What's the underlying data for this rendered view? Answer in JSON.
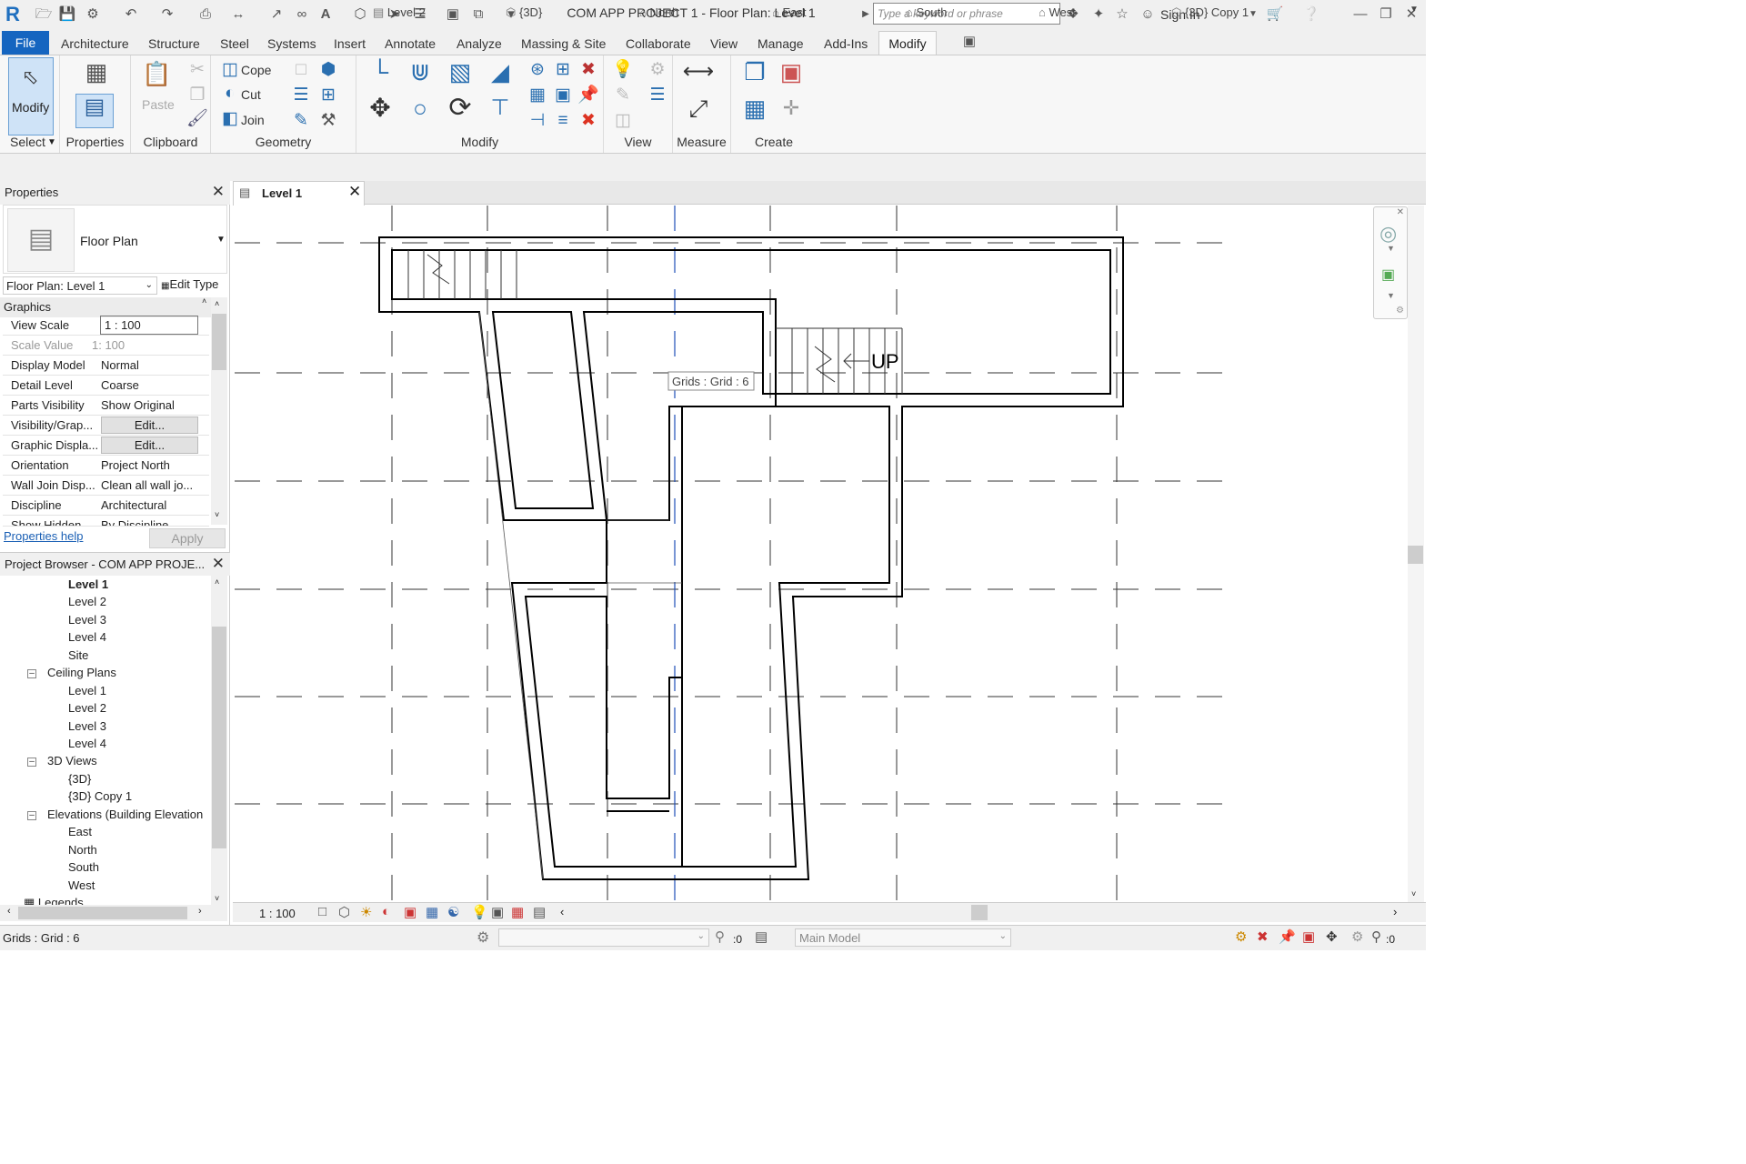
{
  "window": {
    "title": "COM APP PROJECT 1 - Floor Plan: Level 1",
    "search_placeholder": "Type a keyword or phrase",
    "sign_in": "Sign In"
  },
  "menu": [
    "File",
    "Architecture",
    "Structure",
    "Steel",
    "Systems",
    "Insert",
    "Annotate",
    "Analyze",
    "Massing & Site",
    "Collaborate",
    "View",
    "Manage",
    "Add-Ins",
    "Modify"
  ],
  "ribbon": {
    "select": {
      "modify": "Modify",
      "label": "Select"
    },
    "properties": {
      "label": "Properties"
    },
    "clipboard": {
      "paste": "Paste",
      "label": "Clipboard"
    },
    "geometry": {
      "cope": "Cope",
      "cut": "Cut",
      "join": "Join",
      "label": "Geometry"
    },
    "modify_panel": {
      "label": "Modify"
    },
    "view": {
      "label": "View"
    },
    "measure": {
      "label": "Measure"
    },
    "create": {
      "label": "Create"
    }
  },
  "properties": {
    "title": "Properties",
    "type_name": "Floor Plan",
    "instance": "Floor Plan: Level 1",
    "edit_type": "Edit Type",
    "group": "Graphics",
    "rows": [
      {
        "k": "View Scale",
        "v": "1 : 100"
      },
      {
        "k": "Scale Value",
        "v": "1: 100"
      },
      {
        "k": "Display Model",
        "v": "Normal"
      },
      {
        "k": "Detail Level",
        "v": "Coarse"
      },
      {
        "k": "Parts Visibility",
        "v": "Show Original"
      },
      {
        "k": "Visibility/Grap...",
        "v": "Edit..."
      },
      {
        "k": "Graphic Displa...",
        "v": "Edit..."
      },
      {
        "k": "Orientation",
        "v": "Project North"
      },
      {
        "k": "Wall Join Disp...",
        "v": "Clean all wall jo..."
      },
      {
        "k": "Discipline",
        "v": "Architectural"
      },
      {
        "k": "Show Hidden ...",
        "v": "By Discipline"
      }
    ],
    "help": "Properties help",
    "apply": "Apply"
  },
  "browser": {
    "title": "Project Browser - COM APP PROJE...",
    "items": [
      "Level 1",
      "Level 2",
      "Level 3",
      "Level 4",
      "Site",
      "Ceiling Plans",
      "Level 1",
      "Level 2",
      "Level 3",
      "Level 4",
      "3D Views",
      "{3D}",
      "{3D} Copy 1",
      "Elevations (Building Elevation",
      "East",
      "North",
      "South",
      "West",
      "Legends"
    ]
  },
  "tabs": [
    "Level 1",
    "Level 2",
    "{3D}",
    "North",
    "East",
    "South",
    "West",
    "{3D} Copy 1"
  ],
  "canvas": {
    "tooltip": "Grids : Grid : 6",
    "stair_label": "UP"
  },
  "bottom": {
    "scale": "1 : 100"
  },
  "status": {
    "text": "Grids : Grid : 6",
    "model": "Main Model",
    "count1": ":0",
    "count2": ":0"
  }
}
